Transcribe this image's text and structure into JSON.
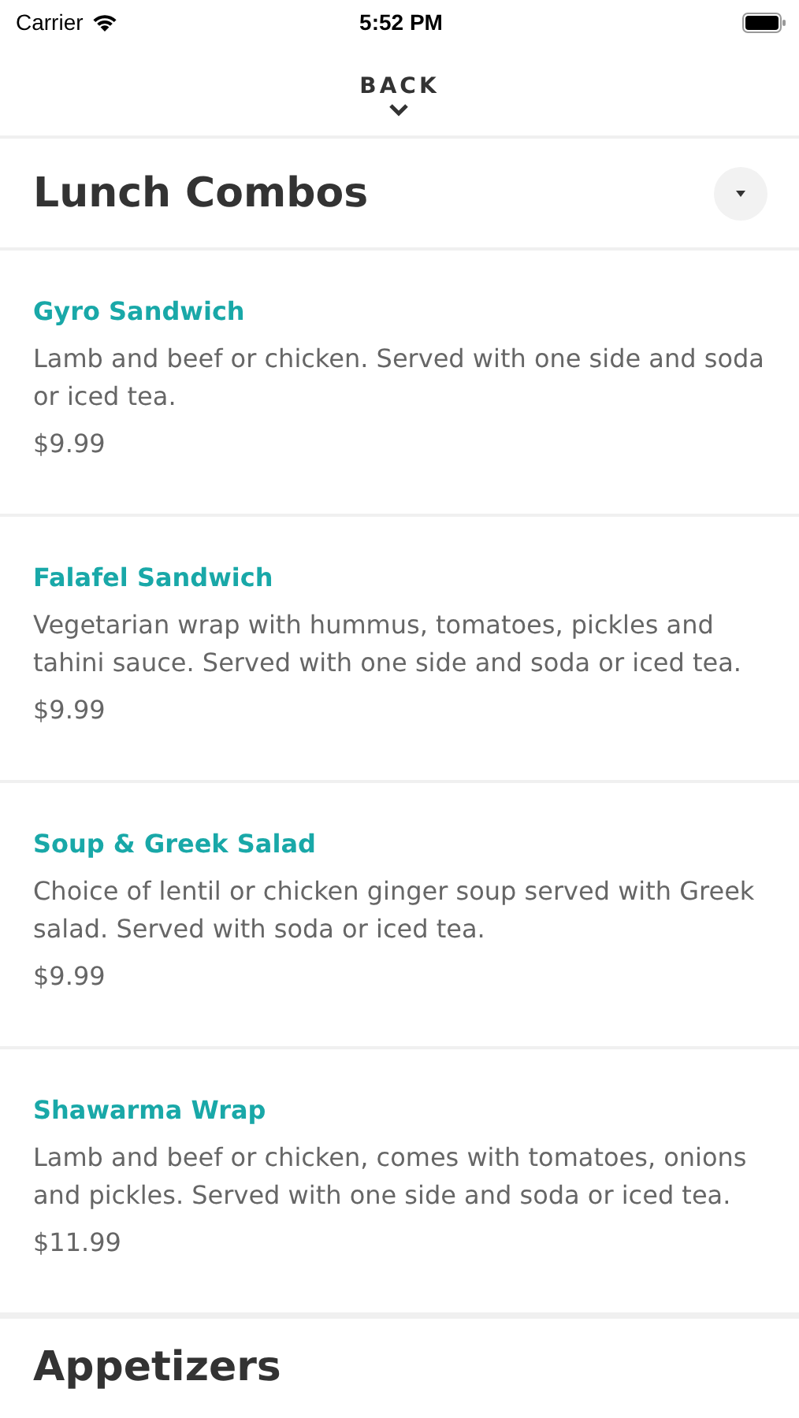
{
  "status_bar": {
    "carrier": "Carrier",
    "time": "5:52 PM"
  },
  "back": {
    "label": "BACK"
  },
  "sections": [
    {
      "title": "Lunch Combos",
      "expanded": true,
      "items": [
        {
          "name": "Gyro Sandwich",
          "description": "Lamb and beef or chicken. Served with one side and soda or iced tea.",
          "price": "$9.99"
        },
        {
          "name": "Falafel Sandwich",
          "description": "Vegetarian wrap with hummus, tomatoes, pickles and tahini sauce. Served with one side and soda or iced tea.",
          "price": "$9.99"
        },
        {
          "name": "Soup & Greek Salad",
          "description": "Choice of lentil or chicken ginger soup served with Greek salad. Served with soda or iced tea.",
          "price": "$9.99"
        },
        {
          "name": "Shawarma Wrap",
          "description": "Lamb and beef or chicken, comes with tomatoes, onions and pickles. Served with one side and soda or iced tea.",
          "price": "$11.99"
        }
      ]
    },
    {
      "title": "Appetizers"
    }
  ]
}
